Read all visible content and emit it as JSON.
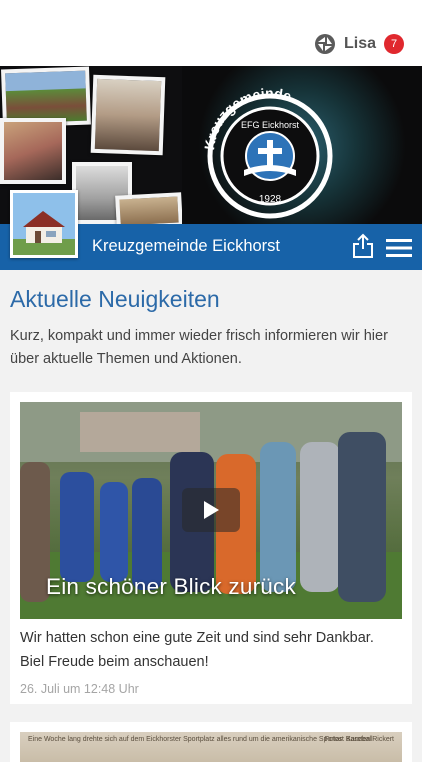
{
  "header": {
    "user_name": "Lisa",
    "notification_count": "7",
    "logo_icon": "spiral-logo-icon"
  },
  "banner": {
    "seal_ring_text": "Kreuzgemeinde",
    "seal_center_text": "EFG   Eickhorst",
    "seal_year": "1928"
  },
  "strip": {
    "title": "Kreuzgemeinde Eickhorst",
    "share_icon": "share-icon",
    "menu_icon": "hamburger-menu-icon"
  },
  "content": {
    "heading": "Aktuelle Neuigkeiten",
    "intro": "Kurz, kompakt und immer wieder frisch informieren wir hier über aktuelle Themen und Aktionen."
  },
  "posts": [
    {
      "video_title": "Ein schöner Blick zurück",
      "text": "Wir hatten schon eine gute Zeit und sind sehr Dankbar. Biel Freude beim anschauen!",
      "date": "26. Juli um 12:48 Uhr"
    },
    {
      "caption_left": "Eine Woche lang drehte sich auf dem Eickhorster Sportplatz alles rund um die amerikanische Sportart Baseball",
      "caption_right": "Fotos: Karsten Rickert"
    }
  ],
  "colors": {
    "brand_blue": "#1762a8",
    "heading_blue": "#2c6aa8",
    "badge_red": "#e0282e"
  }
}
